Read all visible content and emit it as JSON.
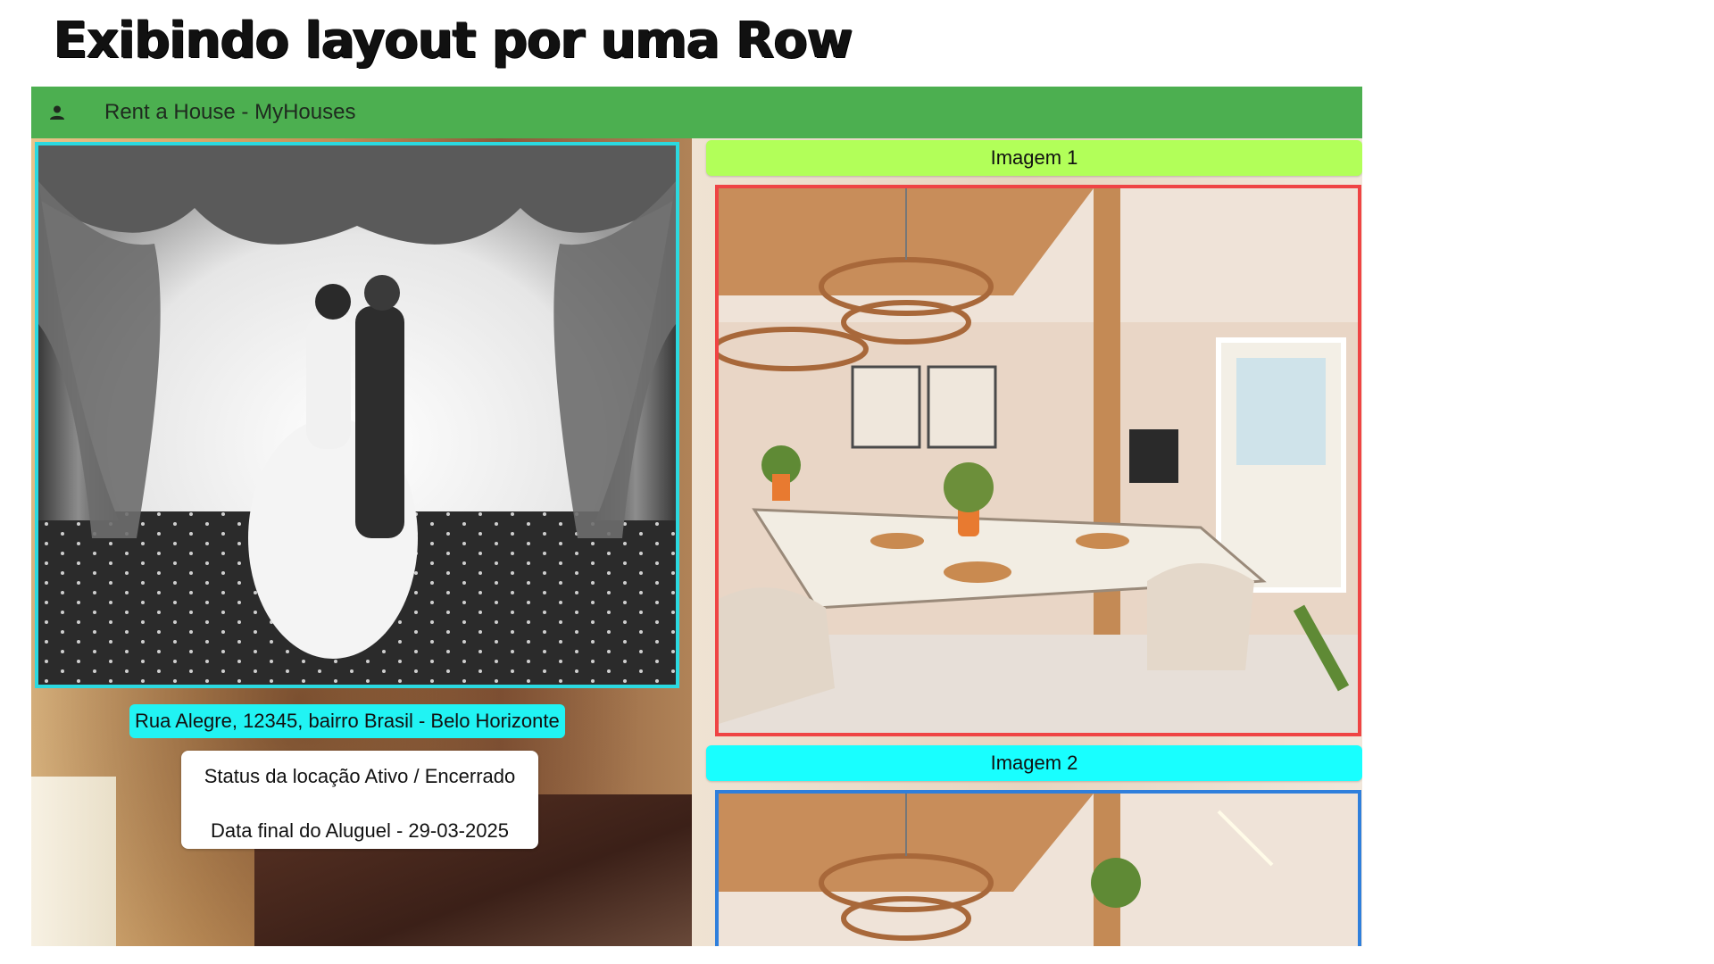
{
  "page_heading": "Exibindo layout por uma Row",
  "appbar": {
    "icon": "person-icon",
    "title": "Rent a House - MyHouses",
    "color": "#4caf50"
  },
  "left_panel": {
    "photo_border_color": "#2bd9e0",
    "address": "Rua Alegre, 12345, bairro Brasil - Belo Horizonte",
    "address_bg": "#21f3f3",
    "status_line": "Status da locação Ativo / Encerrado",
    "end_date_line": "Data final do Aluguel - 29-03-2025"
  },
  "right_panel": {
    "images": [
      {
        "label": "Imagem 1",
        "label_bg": "#b2ff59",
        "border_color": "#ef4444"
      },
      {
        "label": "Imagem 2",
        "label_bg": "#18ffff",
        "border_color": "#2f7fdc"
      }
    ]
  }
}
